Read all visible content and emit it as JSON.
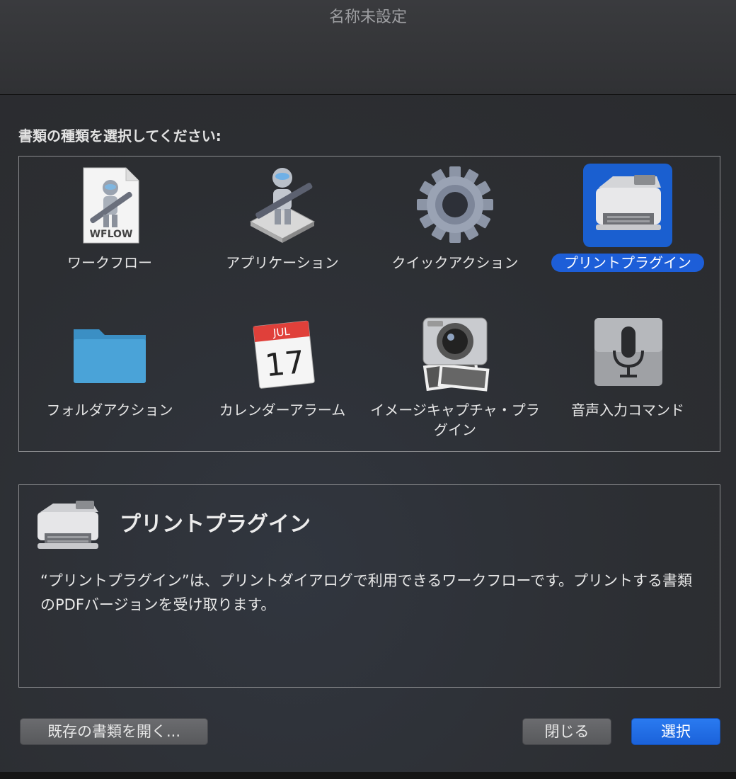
{
  "window": {
    "title": "名称未設定"
  },
  "prompt": "書類の種類を選択してください:",
  "types": [
    {
      "label": "ワークフロー",
      "icon": "workflow-file-icon",
      "selected": false,
      "badge": "WFLOW"
    },
    {
      "label": "アプリケーション",
      "icon": "automator-robot-icon",
      "selected": false
    },
    {
      "label": "クイックアクション",
      "icon": "gear-icon",
      "selected": false
    },
    {
      "label": "プリントプラグイン",
      "icon": "printer-icon",
      "selected": true
    },
    {
      "label": "フォルダアクション",
      "icon": "folder-icon",
      "selected": false
    },
    {
      "label": "カレンダーアラーム",
      "icon": "calendar-icon",
      "selected": false,
      "month": "JUL",
      "day": "17"
    },
    {
      "label": "イメージキャプチャ・プラグイン",
      "icon": "camera-icon",
      "selected": false
    },
    {
      "label": "音声入力コマンド",
      "icon": "microphone-icon",
      "selected": false
    }
  ],
  "description": {
    "title": "プリントプラグイン",
    "text": "“プリントプラグイン”は、プリントダイアログで利用できるワークフローです。プリントする書類のPDFバージョンを受け取ります。"
  },
  "buttons": {
    "open_existing": "既存の書類を開く...",
    "close": "閉じる",
    "choose": "選択"
  },
  "colors": {
    "accent": "#1d5ed8"
  }
}
